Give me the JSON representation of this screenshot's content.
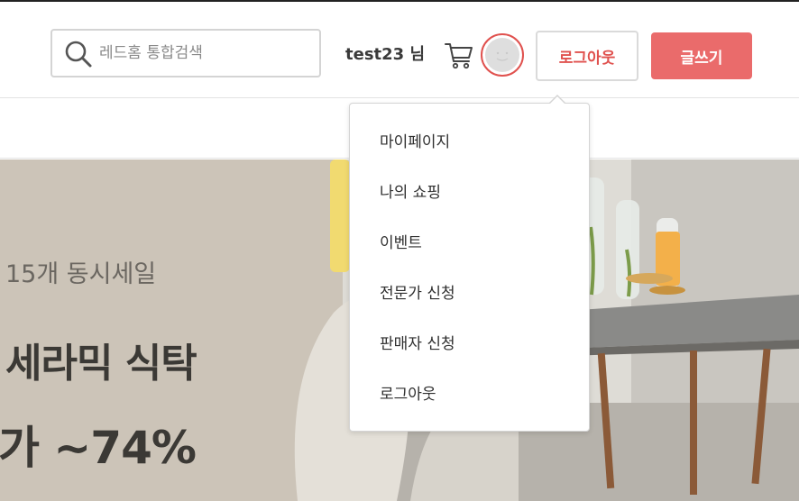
{
  "header": {
    "search": {
      "placeholder": "레드홈 통합검색",
      "value": ""
    },
    "username": "test23 님",
    "logout_label": "로그아웃",
    "write_label": "글쓰기"
  },
  "dropdown": {
    "items": [
      {
        "label": "마이페이지"
      },
      {
        "label": "나의 쇼핑"
      },
      {
        "label": "이벤트"
      },
      {
        "label": "전문가 신청"
      },
      {
        "label": "판매자 신청"
      },
      {
        "label": "로그아웃"
      }
    ]
  },
  "banner": {
    "subtitle": "15개 동시세일",
    "title": "세라믹 식탁",
    "discount": "가 ~74%"
  },
  "icons": {
    "search": "search-icon",
    "cart": "cart-icon",
    "avatar": "avatar-icon"
  },
  "colors": {
    "accent": "#e0524f",
    "write_button": "#ea6b6b",
    "banner_bg": "#ccc4b8"
  }
}
